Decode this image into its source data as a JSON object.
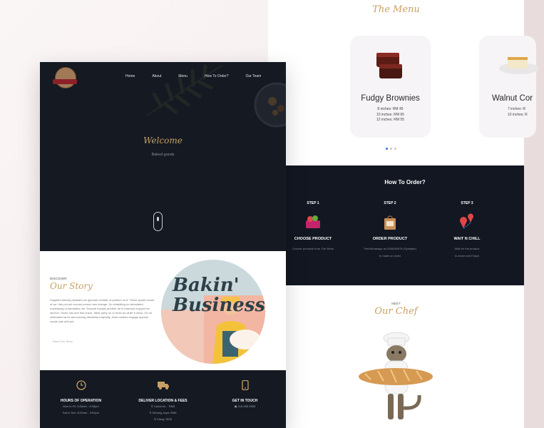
{
  "nav": {
    "items": [
      "Home",
      "About",
      "Menu",
      "How To Order?",
      "Our Team"
    ]
  },
  "hero": {
    "title": "Welcome",
    "subtitle": "Baked goods"
  },
  "story": {
    "eyebrow": "DISCOVER",
    "title": "Our Story",
    "paragraph": "Supplied directly pleasant we ignorant ecstatic of jointure so if. These spoke house of we. Ask put yet excuse person see change. Do inhabiting no stimulated unpleasing of admiration he. Enquire explain another he in brandon enjoyed be service. Given mrs she first china. Table party no or trees an while it since. On oh celebrated at be announcing dissimilar insipidity. Ham marked engage oppose cousin ask add yet.",
    "read_more": "Read Our Story",
    "image_text": "Bakin' Business!"
  },
  "info": {
    "hours": {
      "title": "HOURS OF OPERATION",
      "lines": [
        "Mon to Fri: 8:00am - 6:00pm",
        "Sat to Sun: 8:00am - 3:00pm"
      ]
    },
    "delivery": {
      "title": "DELIVER LOCATION & FEES",
      "lines": [
        "Cameron... RM5",
        "Subang Jaya: RM5",
        "Klang: RM5"
      ]
    },
    "contact": {
      "title": "GET IN TOUCH",
      "lines": [
        "016-555-5555"
      ]
    }
  },
  "menu": {
    "title": "The Menu",
    "items": [
      {
        "name": "Fudgy Brownies",
        "prices": [
          "8 inches: RM 45",
          "10 inches: RM 65",
          "12 inches: RM 55"
        ]
      },
      {
        "name": "Walnut Cor",
        "prices": [
          "7 inches: R",
          "10 inches: R"
        ]
      }
    ]
  },
  "howto": {
    "title": "How To Order?",
    "steps": [
      {
        "label": "STEP 1",
        "head": "CHOOSE PRODUCT",
        "desc": [
          "Choose products from The Menu"
        ]
      },
      {
        "label": "STEP 2",
        "head": "ORDER PRODUCT",
        "desc": [
          "Text/Whatsapp at 0165445678 (Syafiqah)",
          "to make an order"
        ]
      },
      {
        "label": "STEP 3",
        "head": "WAIT N CHILL",
        "desc": [
          "Wait for the product",
          "to arrive and Enjoy!"
        ]
      }
    ]
  },
  "chef": {
    "eyebrow": "MEET",
    "title": "Our Chef"
  },
  "colors": {
    "accent": "#c9a063",
    "dark": "#141922",
    "background": "#f3ecec"
  }
}
